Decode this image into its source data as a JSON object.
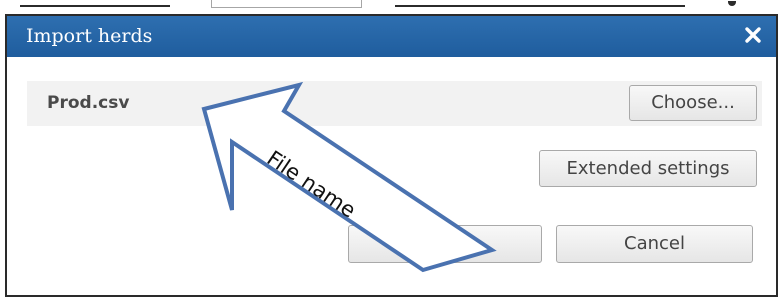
{
  "dialog": {
    "title": "Import herds",
    "file_name": "Prod.csv",
    "choose_label": "Choose...",
    "extended_settings_label": "Extended settings",
    "ok_label": "OK",
    "cancel_label": "Cancel"
  },
  "annotation": {
    "label": "File name"
  },
  "icons": {
    "close": "close-icon"
  },
  "colors": {
    "titlebar": "#2366a8",
    "arrow_outline": "#4a72b0",
    "file_row_bg": "#f2f2f2"
  }
}
